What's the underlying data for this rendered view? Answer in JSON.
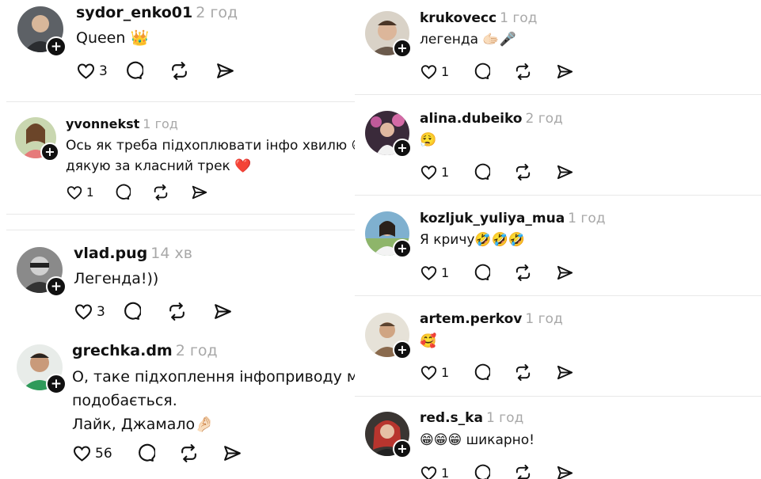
{
  "left": {
    "comments": [
      {
        "username": "sydor_enko01",
        "time": "2 год",
        "text": "Queen 👑",
        "likes": "3"
      },
      {
        "username": "yvonnekst",
        "time": "1 год",
        "text_line1": "Ось як треба підхоплювати інфо хвилю 😁 😂",
        "text_line2": "дякую за класний трек ❤️",
        "likes": "1"
      },
      {
        "username": "vlad.pug",
        "time": "14 хв",
        "text": "Легенда!))",
        "likes": "3"
      },
      {
        "username": "grechka.dm",
        "time": "2 год",
        "text_line1": "О, таке підхоплення інфоприводу мені",
        "text_line2": "подобається.",
        "text_line3": "Лайк, Джамало🤌🏻",
        "likes": "56"
      }
    ]
  },
  "right": {
    "comments": [
      {
        "username": "krukovecc",
        "time": "1 год",
        "text": "легенда 🫱🏻🎤",
        "likes": "1"
      },
      {
        "username": "alina.dubeiko",
        "time": "2 год",
        "text": "😮‍💨",
        "likes": "1"
      },
      {
        "username": "kozljuk_yuliya_mua",
        "time": "1 год",
        "text": "Я кричу🤣🤣🤣",
        "likes": "1"
      },
      {
        "username": "artem.perkov",
        "time": "1 год",
        "text": "🥰",
        "likes": "1"
      },
      {
        "username": "red.s_ka",
        "time": "1 год",
        "text": "😁😁😁 шикарно!",
        "likes": "1"
      }
    ]
  },
  "icons": {
    "like": "heart-icon",
    "reply": "comment-bubble-icon",
    "repost": "repost-icon",
    "share": "share-icon",
    "follow": "plus-icon"
  }
}
